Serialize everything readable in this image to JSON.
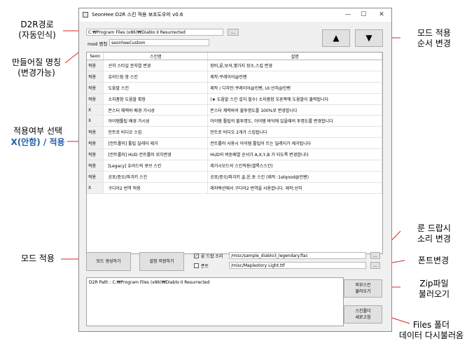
{
  "window": {
    "title": "SeonHee D2R 스킨 적용 보조도우미 v0.6",
    "min_glyph": "—",
    "max_glyph": "☐",
    "close_glyph": "✕"
  },
  "path_field": {
    "value": "C:₩Program Files (x86)₩Diablo II Resurrected"
  },
  "browse_button": {
    "label": "..."
  },
  "mod_name": {
    "label": "mod 명칭",
    "value": "seonheeCustom"
  },
  "order_buttons": {
    "up": "▲",
    "down": "▼"
  },
  "table": {
    "columns": [
      "Seon",
      "스킨명",
      "설명"
    ],
    "rows": [
      [
        "적용",
        "선히 스타일 문자열 변경",
        "장비,룬,보석,몇가지 장소,스킬 변경"
      ],
      [
        "적용",
        "호라드림 함 스킨",
        "제작:쿠레이어@인벤"
      ],
      [
        "적용",
        "도움말 스킨",
        "제작 / 디자인:쿠레이어@인벤, UI:선히@인벤"
      ],
      [
        "적용",
        "소지품함 도움말 확장",
        "(★ 도움말 스킨 설치 필수) 소지품함 오른쪽에 도움말이 출력됩니다"
      ],
      [
        "X",
        "몬스터 체력바 배경 가시성",
        "몬스터 체력바의 불투명도를 100%로 변경합니다"
      ],
      [
        "X",
        "아이템툴팁 배경 가시성",
        "아이템 툴팁의 불투명도, 아이템 바닥에 있을때의 투명도를 변경합니다"
      ],
      [
        "적용",
        "인트로 비디오 스킵",
        "인트로 비디오 2개가 스킵됩니다"
      ],
      [
        "적용",
        "[컨트롤러] 툴팁 딜레이 제거",
        "컨트롤러 사용시 아이템 툴팁이 뜨는 딜레이가 제거됩니다"
      ],
      [
        "적용",
        "[컨트롤러] HUD 컨트롤러 위치변경",
        "HUD의 버튼배열 순서가 A,X,Y,B 가 되도록 변경합니다"
      ],
      [
        "적용",
        "[Legacy] 호라드릭 큐브 스킨",
        "레거시모드의 스킨적용(셀록스스킨)"
      ],
      [
        "적용",
        "공포/증오/파괴키 스킨",
        "공포/증오/파괴키 골,운,동 스킨 (제작 :1elqnod@인벤)"
      ],
      [
        "X",
        "구디아2 번역 적용",
        "레저렉션에서 구디아2 번역을 사용합니다. 제작:선히"
      ]
    ]
  },
  "buttons": {
    "create_mod": "모드 생성하기",
    "save_settings": "설정 저장하기",
    "load_external_skin": "외부스킨\n불러오기",
    "reload_skin_folder": "스킨폴더\n새로고침"
  },
  "rune_sound": {
    "checked": true,
    "label": "룬 드랍 소리",
    "value": "/misc/sample_diablo3_legendary.flac"
  },
  "font": {
    "checked": false,
    "label": "폰트",
    "value": "/misc/Maplestory Light.ttf"
  },
  "log": {
    "text": "D2R Path : C:₩Program Files (x86)₩Diablo II Resurrected"
  },
  "annotations": {
    "d2r_path": "D2R경로\n(자동인식)",
    "mod_name": "만들어질 명칭\n(변경가능)",
    "apply_select": "적용여부 선택",
    "apply_select_values": "X(안함) / 적용",
    "mod_apply": "모드 적용",
    "order_change": "모드 적용\n순서 변경",
    "rune_sound_change": "룬 드랍시\n소리 변경",
    "font_change": "폰트변경",
    "zip_load": "Zip파일\n불러오기",
    "files_reload": "Files 폴더\n데이터 다시불러옴"
  },
  "colors": {
    "arrow": "#e02020",
    "highlight_text": "#1f5fa8"
  }
}
